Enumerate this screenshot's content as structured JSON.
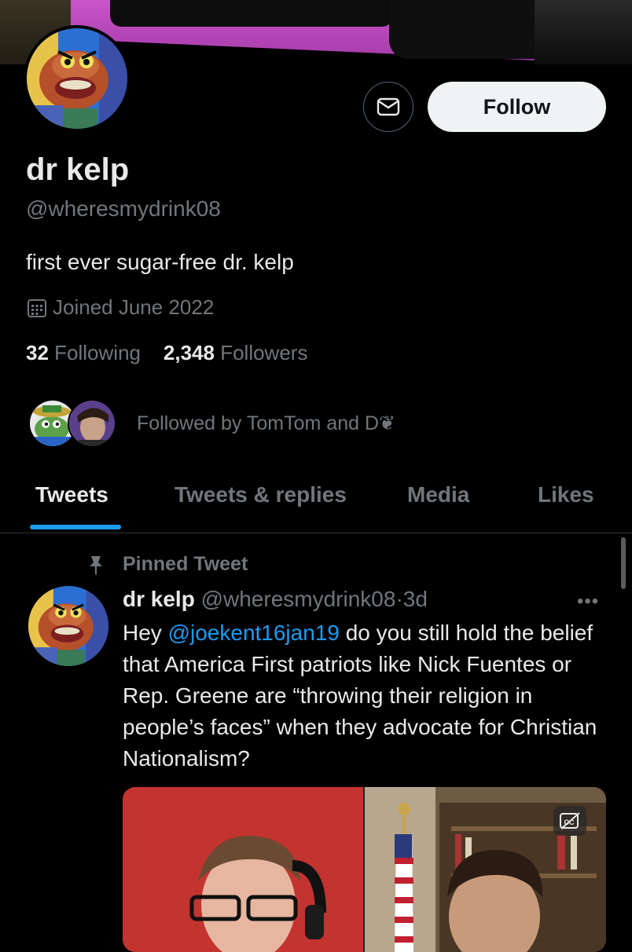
{
  "profile": {
    "display_name": "dr kelp",
    "handle": "@wheresmydrink08",
    "bio": "first ever sugar-free dr. kelp",
    "joined": "Joined June 2022",
    "following_count": "32",
    "following_label": "Following",
    "followers_count": "2,348",
    "followers_label": "Followers",
    "followed_by": "Followed by TomTom and D❦"
  },
  "actions": {
    "follow_label": "Follow",
    "message_icon": "mail-icon"
  },
  "tabs": [
    {
      "label": "Tweets",
      "active": true
    },
    {
      "label": "Tweets & replies",
      "active": false
    },
    {
      "label": "Media",
      "active": false
    },
    {
      "label": "Likes",
      "active": false
    }
  ],
  "pinned_tweet": {
    "pinned_label": "Pinned Tweet",
    "author_name": "dr kelp",
    "author_handle": "@wheresmydrink08",
    "separator": "·",
    "age": "3d",
    "more_label": "•••",
    "text_before": "Hey ",
    "mention": "@joekent16jan19",
    "text_after": " do you still hold the belief that America First patriots like Nick Fuentes or Rep. Greene are “throwing their religion in people’s faces” when they advocate for Christian Nationalism?",
    "media_captions_icon": "captions-off-icon"
  },
  "colors": {
    "background": "#000000",
    "accent": "#1d9bf0",
    "muted_text": "#71767b",
    "primary_text": "#e7e9ea",
    "follow_button_bg": "#eff3f4"
  }
}
